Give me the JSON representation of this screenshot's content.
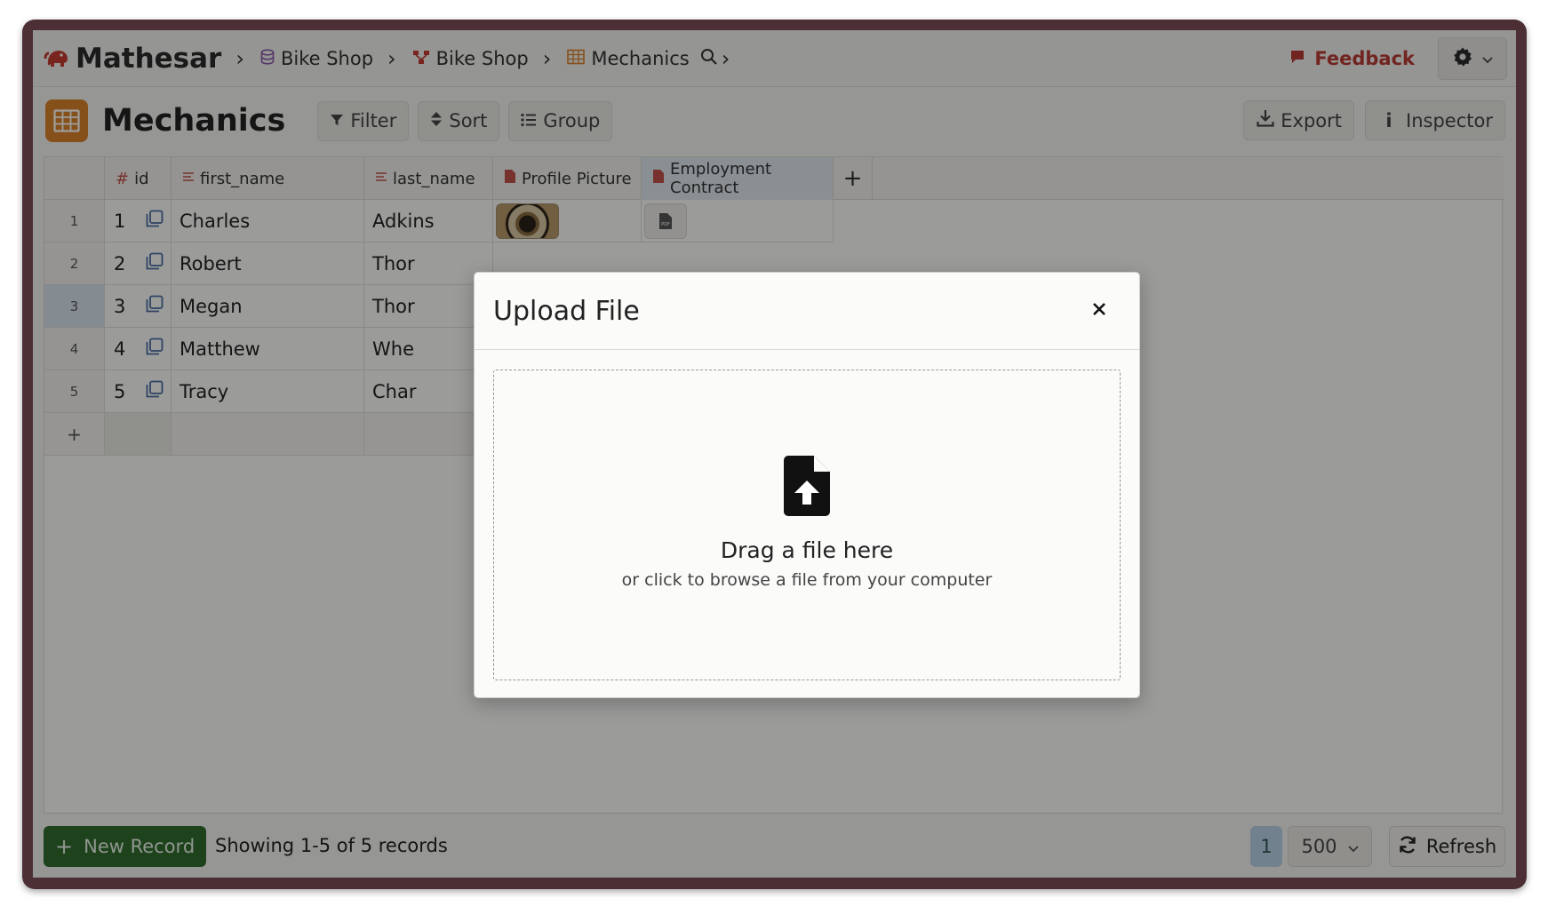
{
  "app": {
    "name": "Mathesar",
    "breadcrumbs": [
      {
        "label": "Bike Shop",
        "icon": "database-icon"
      },
      {
        "label": "Bike Shop",
        "icon": "schema-icon"
      },
      {
        "label": "Mechanics",
        "icon": "table-icon"
      }
    ],
    "feedback_label": "Feedback"
  },
  "toolbar": {
    "title": "Mechanics",
    "filter_label": "Filter",
    "sort_label": "Sort",
    "group_label": "Group",
    "export_label": "Export",
    "inspector_label": "Inspector"
  },
  "table": {
    "columns": [
      {
        "label": "id",
        "icon": "hash-icon"
      },
      {
        "label": "first_name",
        "icon": "text-icon"
      },
      {
        "label": "last_name",
        "icon": "text-icon"
      },
      {
        "label": "Profile Picture",
        "icon": "file-icon"
      },
      {
        "label": "Employment Contract",
        "icon": "file-icon"
      }
    ],
    "rows": [
      {
        "num": "1",
        "id": "1",
        "first_name": "Charles",
        "last_name": "Adkins"
      },
      {
        "num": "2",
        "id": "2",
        "first_name": "Robert",
        "last_name": "Thor"
      },
      {
        "num": "3",
        "id": "3",
        "first_name": "Megan",
        "last_name": "Thor"
      },
      {
        "num": "4",
        "id": "4",
        "first_name": "Matthew",
        "last_name": "Whe"
      },
      {
        "num": "5",
        "id": "5",
        "first_name": "Tracy",
        "last_name": "Char"
      }
    ],
    "add_row_label": "+",
    "add_column_label": "+",
    "pdf_label": "PDF"
  },
  "footer": {
    "new_record_label": "New Record",
    "showing_text": "Showing 1-5 of 5 records",
    "page": "1",
    "page_size": "500",
    "refresh_label": "Refresh"
  },
  "modal": {
    "title": "Upload File",
    "close_label": "×",
    "drop_title": "Drag a file here",
    "drop_subtitle": "or click to browse a file from your computer"
  },
  "colors": {
    "accent_orange": "#d9822b",
    "primary_green": "#2f6b2e",
    "feedback_red": "#b73a35",
    "selected_blue": "#d5e0ea"
  }
}
